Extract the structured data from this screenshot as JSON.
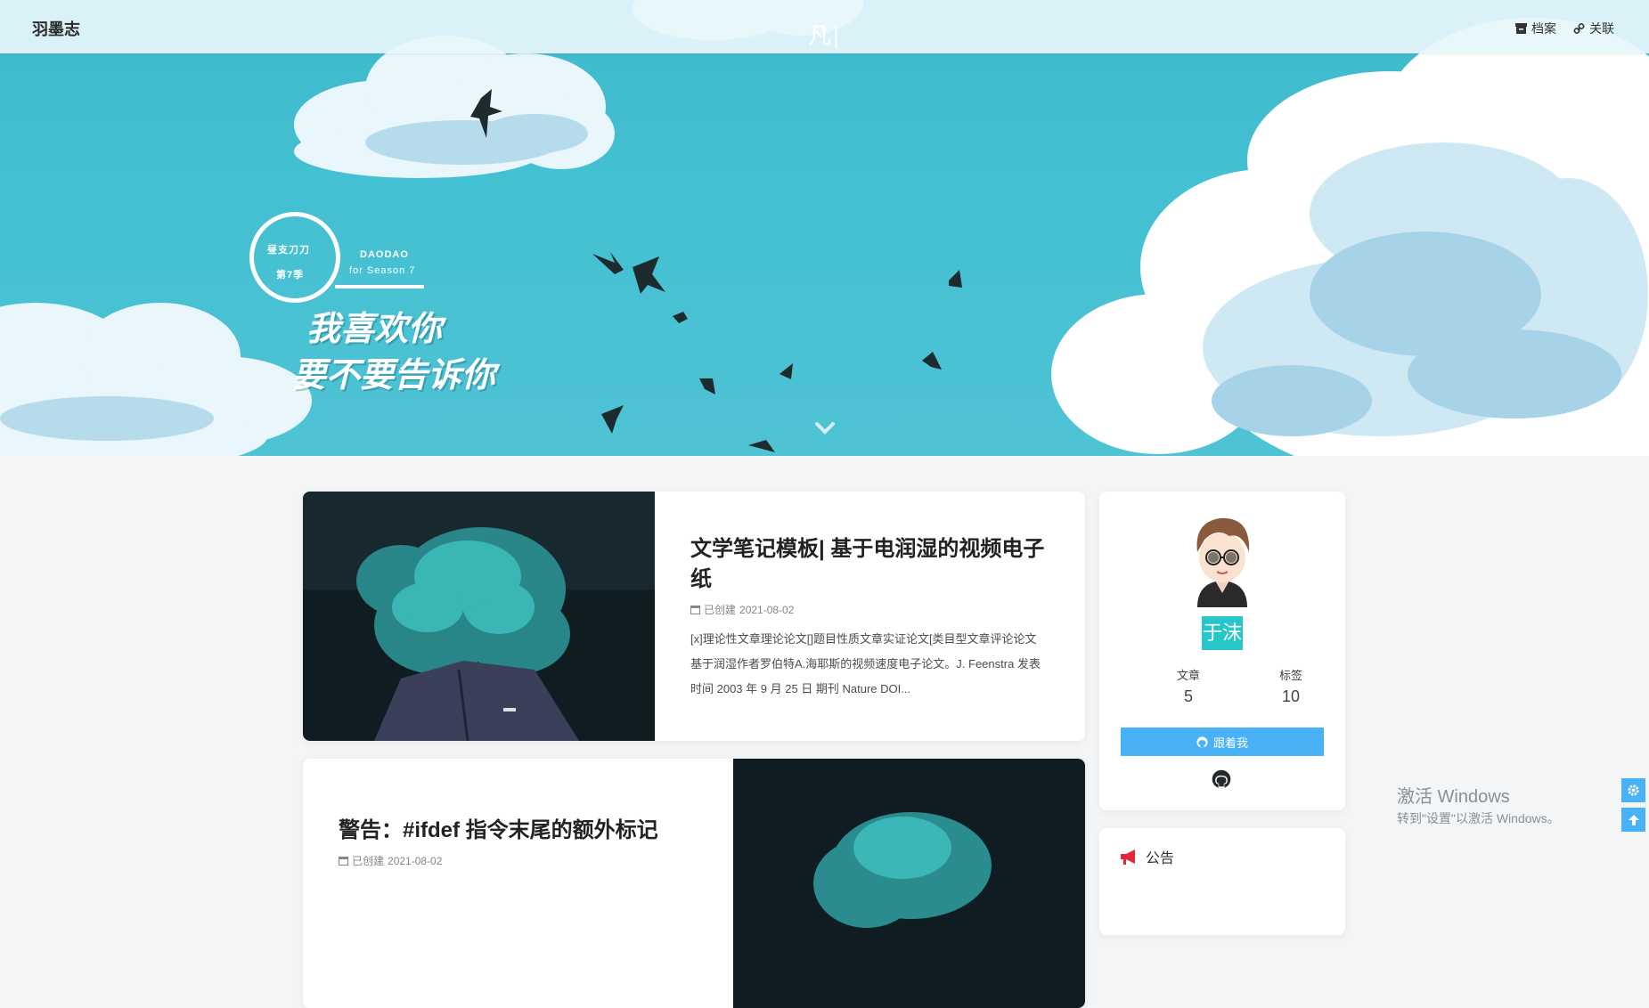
{
  "navbar": {
    "brand": "羽墨志",
    "subtitle": "凡|",
    "archive_label": "档案",
    "links_label": "关联"
  },
  "hero": {
    "season_top_left": "昼支刀刀",
    "season_bottom_left": "第7季",
    "season_en_1": "DAODAO",
    "season_en_2": "for Season 7",
    "script_line_1": "我喜欢你",
    "script_line_2": "要不要告诉你"
  },
  "posts": [
    {
      "title": "文学笔记模板| 基于电润湿的视频电子纸",
      "meta_label": "已创建",
      "date": "2021-08-02",
      "excerpt": "[x]理论性文章理论论文[]题目性质文章实证论文[类目型文章评论论文基于润湿作者罗伯特A.海耶斯的视频速度电子论文。J. Feenstra 发表时间 2003 年 9 月 25 日 期刊 Nature DOI..."
    },
    {
      "title": "警告：#ifdef 指令末尾的额外标记",
      "meta_label": "已创建",
      "date": "2021-08-02"
    }
  ],
  "profile": {
    "name": "于沫",
    "posts_label": "文章",
    "posts_count": "5",
    "tags_label": "标签",
    "tags_count": "10",
    "follow_label": "跟着我"
  },
  "announcement": {
    "title": "公告"
  },
  "windows": {
    "line1": "激活 Windows",
    "line2": "转到\"设置\"以激活 Windows。"
  },
  "colors": {
    "accent": "#49b1f5",
    "name_badge": "#26c6c9",
    "hero_sky": "#43c0d2"
  }
}
